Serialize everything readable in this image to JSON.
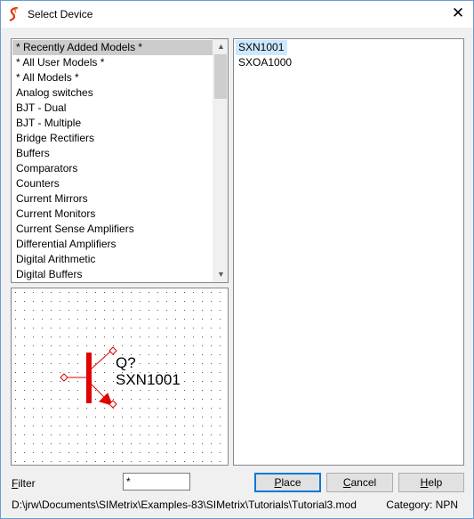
{
  "window": {
    "title": "Select Device",
    "close_glyph": "✕"
  },
  "categories": {
    "items": [
      "* Recently Added Models *",
      "* All User Models *",
      "* All Models *",
      "Analog switches",
      "BJT - Dual",
      "BJT - Multiple",
      "Bridge Rectifiers",
      "Buffers",
      "Comparators",
      "Counters",
      "Current Mirrors",
      "Current Monitors",
      "Current Sense Amplifiers",
      "Differential Amplifiers",
      "Digital Arithmetic",
      "Digital Buffers"
    ],
    "selected_index": 0
  },
  "models": {
    "items": [
      "SXN1001",
      "SXOA1000"
    ],
    "selected_index": 0
  },
  "preview": {
    "ref_label": "Q?",
    "part_label": "SXN1001",
    "symbol_color": "#e00000"
  },
  "filter": {
    "label_first": "F",
    "label_rest": "ilter",
    "value": "*"
  },
  "buttons": {
    "place_first": "P",
    "place_rest": "lace",
    "cancel_first": "C",
    "cancel_rest": "ancel",
    "help_first": "H",
    "help_rest": "elp"
  },
  "status": {
    "path": "D:\\jrw\\Documents\\SIMetrix\\Examples-83\\SIMetrix\\Tutorials\\Tutorial3.mod",
    "category": "Category: NPN"
  },
  "colors": {
    "selection_gray": "#cccccc",
    "selection_blue": "#cce8ff",
    "default_button_border": "#0078d7"
  }
}
